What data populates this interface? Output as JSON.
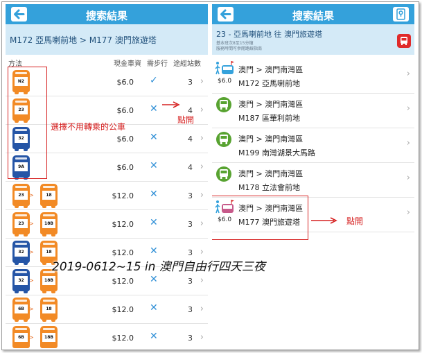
{
  "left": {
    "title": "搜索結果",
    "route": "M172 亞馬喇前地 > M177 澳門旅遊塔",
    "headers": {
      "method": "方法",
      "fare": "現金車資",
      "walk": "需步行",
      "stops": "途經站數"
    },
    "rows": [
      {
        "buses": [
          {
            "label": "N2",
            "color": "orange"
          }
        ],
        "fare": "$6.0",
        "walk": "check",
        "walk_glyph": "✓",
        "stops": "3"
      },
      {
        "buses": [
          {
            "label": "23",
            "color": "orange"
          }
        ],
        "fare": "$6.0",
        "walk": "cross",
        "walk_glyph": "✕",
        "stops": "4"
      },
      {
        "buses": [
          {
            "label": "32",
            "color": "blue"
          }
        ],
        "fare": "$6.0",
        "walk": "cross",
        "walk_glyph": "✕",
        "stops": "4"
      },
      {
        "buses": [
          {
            "label": "9A",
            "color": "blue"
          }
        ],
        "fare": "$6.0",
        "walk": "cross",
        "walk_glyph": "✕",
        "stops": "4"
      },
      {
        "buses": [
          {
            "label": "23",
            "color": "orange"
          },
          {
            "label": "18",
            "color": "orange"
          }
        ],
        "fare": "$12.0",
        "walk": "cross",
        "walk_glyph": "✕",
        "stops": "3"
      },
      {
        "buses": [
          {
            "label": "23",
            "color": "orange"
          },
          {
            "label": "18B",
            "color": "orange"
          }
        ],
        "fare": "$12.0",
        "walk": "cross",
        "walk_glyph": "✕",
        "stops": "3"
      },
      {
        "buses": [
          {
            "label": "32",
            "color": "blue"
          },
          {
            "label": "18",
            "color": "orange"
          }
        ],
        "fare": "$12.0",
        "walk": "cross",
        "walk_glyph": "✕",
        "stops": "3"
      },
      {
        "buses": [
          {
            "label": "32",
            "color": "blue"
          },
          {
            "label": "18B",
            "color": "orange"
          }
        ],
        "fare": "$12.0",
        "walk": "cross",
        "walk_glyph": "✕",
        "stops": "3"
      },
      {
        "buses": [
          {
            "label": "6B",
            "color": "orange"
          },
          {
            "label": "18",
            "color": "orange"
          }
        ],
        "fare": "$12.0",
        "walk": "cross",
        "walk_glyph": "✕",
        "stops": "3"
      },
      {
        "buses": [
          {
            "label": "6B",
            "color": "orange"
          },
          {
            "label": "18B",
            "color": "orange"
          }
        ],
        "fare": "$12.0",
        "walk": "cross",
        "walk_glyph": "✕",
        "stops": "3"
      }
    ],
    "transfer_glyph": ">",
    "annotation_select": "選擇不用轉乘的公車",
    "annotation_open": "點開"
  },
  "right": {
    "title": "搜索結果",
    "route": "23 - 亞馬喇前地 往 澳門旅遊塔",
    "sub1": "基本班次8至15分鐘",
    "sub2": "服務時間可參閱路線指南",
    "fare": "$6.0",
    "rows": [
      {
        "icon": "walk-bus",
        "line1": "澳門 > 澳門南灣區",
        "line2": "M172 亞馬喇前地",
        "show_fare": true
      },
      {
        "icon": "bus-stop",
        "line1": "澳門 > 澳門南灣區",
        "line2": "M187 區華利前地",
        "show_fare": false
      },
      {
        "icon": "bus-stop",
        "line1": "澳門 > 澳門南灣區",
        "line2": "M199 南灣湖景大馬路",
        "show_fare": false
      },
      {
        "icon": "bus-stop",
        "line1": "澳門 > 澳門南灣區",
        "line2": "M178 立法會前地",
        "show_fare": false
      },
      {
        "icon": "bus-walk",
        "line1": "澳門 > 澳門南灣區",
        "line2": "M177 澳門旅遊塔",
        "show_fare": true
      }
    ],
    "annotation_open": "點開"
  },
  "watermark": "2019-0612~15 in 澳門自由行四天三夜",
  "colors": {
    "header_blue": "#34a1db",
    "band": "#d4eaf7",
    "bus_orange": "#f28a25",
    "bus_blue": "#2555a6",
    "stop_green": "#58a331",
    "annotation_red": "#d62020"
  }
}
